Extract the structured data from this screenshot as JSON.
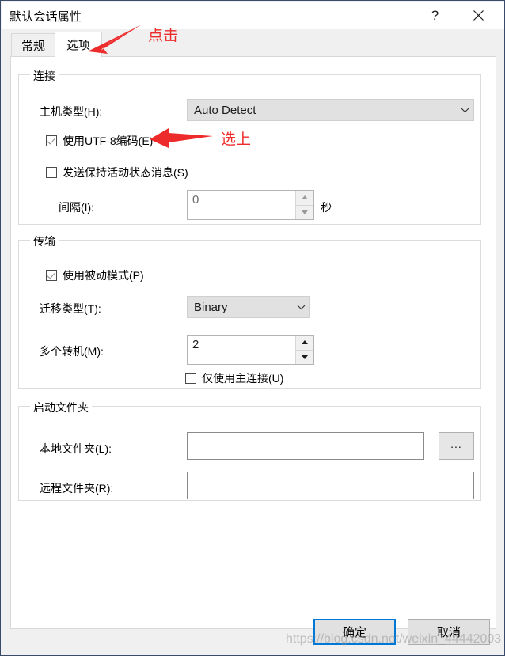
{
  "window": {
    "title": "默认会话属性",
    "help_icon": "question-mark-icon",
    "close_icon": "close-icon",
    "border_color": "#3a4a6b"
  },
  "tabs": [
    {
      "label": "常规",
      "selected": false
    },
    {
      "label": "选项",
      "selected": true
    }
  ],
  "groups": {
    "connection": {
      "title": "连接",
      "host_type": {
        "label": "主机类型(H):",
        "value": "Auto Detect",
        "dropdown_icon": "chevron-down-icon"
      },
      "utf8": {
        "label": "使用UTF-8编码(E)",
        "checked": true
      },
      "keepalive": {
        "label": "发送保持活动状态消息(S)",
        "checked": false
      },
      "interval": {
        "label": "间隔(I):",
        "value": "0",
        "unit": "秒",
        "enabled": false
      }
    },
    "transfer": {
      "title": "传输",
      "passive": {
        "label": "使用被动模式(P)",
        "checked": true
      },
      "transfer_type": {
        "label": "迁移类型(T):",
        "value": "Binary",
        "dropdown_icon": "chevron-down-icon"
      },
      "multiple": {
        "label": "多个转机(M):",
        "value": "2",
        "enabled": true
      },
      "main_only": {
        "label": "仅使用主连接(U)",
        "checked": false
      }
    },
    "startup": {
      "title": "启动文件夹",
      "local": {
        "label": "本地文件夹(L):",
        "value": "",
        "placeholder": ""
      },
      "browse_label": "...",
      "remote": {
        "label": "远程文件夹(R):",
        "value": "",
        "placeholder": ""
      }
    }
  },
  "footer": {
    "ok_label": "确定",
    "cancel_label": "取消",
    "ok_accent_color": "#0078d7"
  },
  "annotations": {
    "color": "#ee2b2b",
    "click_label": "点击",
    "select_label": "选上"
  },
  "watermark": {
    "text": "https://blog.csdn.net/weixin_44442003"
  }
}
